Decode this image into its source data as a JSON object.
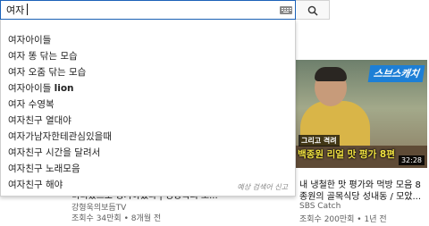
{
  "search": {
    "value": "여자",
    "button_icon": "search-icon",
    "keyboard_icon": "keyboard-icon"
  },
  "suggestions": [
    {
      "prefix": "여자아이들",
      "bold": ""
    },
    {
      "prefix": "여자 똥 닦는 모습",
      "bold": ""
    },
    {
      "prefix": "여자 오줌 닦는 모습",
      "bold": ""
    },
    {
      "prefix": "여자아이들 ",
      "bold": "lion"
    },
    {
      "prefix": "여자 수영복",
      "bold": ""
    },
    {
      "prefix": "여자친구 열대야",
      "bold": ""
    },
    {
      "prefix": "여자가남자한테관심있을때",
      "bold": ""
    },
    {
      "prefix": "여자친구 시간을 달려서",
      "bold": ""
    },
    {
      "prefix": "여자친구 노래모음",
      "bold": ""
    },
    {
      "prefix": "여자친구 해야",
      "bold": ""
    }
  ],
  "report_text": "예상 검색어 신고",
  "video_left": {
    "title": "비디었스도 평가하였다 | 영양복의 노...",
    "channel": "강형욱의보듬TV",
    "stats": "조회수 34만회 • 8개월 전"
  },
  "video_right": {
    "thumb_brand": "스브스캐치",
    "thumb_caption1": "그리고 격려",
    "thumb_caption2": "백종원 리얼 맛 평가 8편",
    "duration": "32:28",
    "title_line1": "내 냉철한 맛 평가와 먹방 모음 8",
    "title_line2": "종원의 골목식당 성내동 / 모았...",
    "channel": "SBS Catch",
    "stats": "조회수 200만회 • 1년 전"
  },
  "colors": {
    "focus_border": "#1c62b9",
    "brand_blue": "#1d7fd6",
    "caption_yellow": "#f4e542"
  }
}
